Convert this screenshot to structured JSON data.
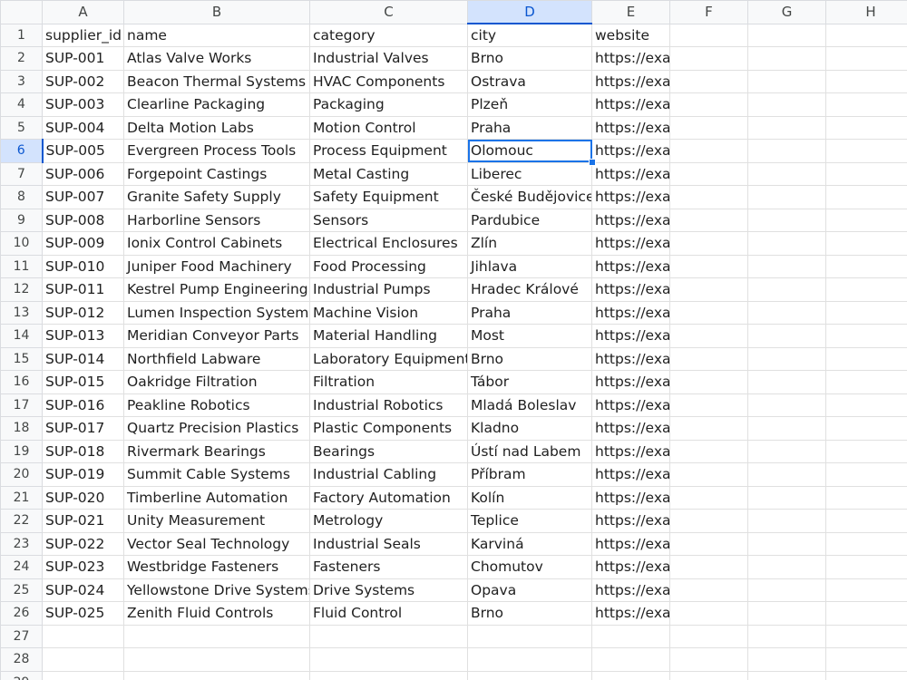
{
  "sheet": {
    "columns": [
      "A",
      "B",
      "C",
      "D",
      "E",
      "F",
      "G",
      "H"
    ],
    "selected_column": "D",
    "selected_row": 6,
    "selected_cell": "D6",
    "rows": [
      [
        "supplier_id",
        "name",
        "category",
        "city",
        "website",
        "",
        "",
        ""
      ],
      [
        "SUP-001",
        "Atlas Valve Works",
        "Industrial Valves",
        "Brno",
        "https://example.invalid/atlas-valve",
        "",
        "",
        ""
      ],
      [
        "SUP-002",
        "Beacon Thermal Systems",
        "HVAC Components",
        "Ostrava",
        "https://example.invalid/beacon-thermal",
        "",
        "",
        ""
      ],
      [
        "SUP-003",
        "Clearline Packaging",
        "Packaging",
        "Plzeň",
        "https://example.invalid/clearline",
        "",
        "",
        ""
      ],
      [
        "SUP-004",
        "Delta Motion Labs",
        "Motion Control",
        "Praha",
        "https://example.invalid/delta-motion",
        "",
        "",
        ""
      ],
      [
        "SUP-005",
        "Evergreen Process Tools",
        "Process Equipment",
        "Olomouc",
        "https://example.invalid/evergreen-process",
        "",
        "",
        ""
      ],
      [
        "SUP-006",
        "Forgepoint Castings",
        "Metal Casting",
        "Liberec",
        "https://example.invalid/forgepoint",
        "",
        "",
        ""
      ],
      [
        "SUP-007",
        "Granite Safety Supply",
        "Safety Equipment",
        "České Budějovice",
        "https://example.invalid/granite-safety",
        "",
        "",
        ""
      ],
      [
        "SUP-008",
        "Harborline Sensors",
        "Sensors",
        "Pardubice",
        "https://example.invalid/harborline",
        "",
        "",
        ""
      ],
      [
        "SUP-009",
        "Ionix Control Cabinets",
        "Electrical Enclosures",
        "Zlín",
        "https://example.invalid/ionix",
        "",
        "",
        ""
      ],
      [
        "SUP-010",
        "Juniper Food Machinery",
        "Food Processing",
        "Jihlava",
        "https://example.invalid/juniper-food",
        "",
        "",
        ""
      ],
      [
        "SUP-011",
        "Kestrel Pump Engineering",
        "Industrial Pumps",
        "Hradec Králové",
        "https://example.invalid/kestrel-pump",
        "",
        "",
        ""
      ],
      [
        "SUP-012",
        "Lumen Inspection Systems",
        "Machine Vision",
        "Praha",
        "https://example.invalid/lumen-inspection",
        "",
        "",
        ""
      ],
      [
        "SUP-013",
        "Meridian Conveyor Parts",
        "Material Handling",
        "Most",
        "https://example.invalid/meridian-conveyor",
        "",
        "",
        ""
      ],
      [
        "SUP-014",
        "Northfield Labware",
        "Laboratory Equipment",
        "Brno",
        "https://example.invalid/northfield-labware",
        "",
        "",
        ""
      ],
      [
        "SUP-015",
        "Oakridge Filtration",
        "Filtration",
        "Tábor",
        "https://example.invalid/oakridge-filtration",
        "",
        "",
        ""
      ],
      [
        "SUP-016",
        "Peakline Robotics",
        "Industrial Robotics",
        "Mladá Boleslav",
        "https://example.invalid/peakline-robotics",
        "",
        "",
        ""
      ],
      [
        "SUP-017",
        "Quartz Precision Plastics",
        "Plastic Components",
        "Kladno",
        "https://example.invalid/quartz-plastics",
        "",
        "",
        ""
      ],
      [
        "SUP-018",
        "Rivermark Bearings",
        "Bearings",
        "Ústí nad Labem",
        "https://example.invalid/rivermark-bearings",
        "",
        "",
        ""
      ],
      [
        "SUP-019",
        "Summit Cable Systems",
        "Industrial Cabling",
        "Příbram",
        "https://example.invalid/summit-cable",
        "",
        "",
        ""
      ],
      [
        "SUP-020",
        "Timberline Automation",
        "Factory Automation",
        "Kolín",
        "https://example.invalid/timberline-automatio",
        "",
        "",
        ""
      ],
      [
        "SUP-021",
        "Unity Measurement",
        "Metrology",
        "Teplice",
        "https://example.invalid/unity-measurement",
        "",
        "",
        ""
      ],
      [
        "SUP-022",
        "Vector Seal Technology",
        "Industrial Seals",
        "Karviná",
        "https://example.invalid/vector-seal",
        "",
        "",
        ""
      ],
      [
        "SUP-023",
        "Westbridge Fasteners",
        "Fasteners",
        "Chomutov",
        "https://example.invalid/westbridge-fasteners",
        "",
        "",
        ""
      ],
      [
        "SUP-024",
        "Yellowstone Drive Systems",
        "Drive Systems",
        "Opava",
        "https://example.invalid/yellowstone-drive",
        "",
        "",
        ""
      ],
      [
        "SUP-025",
        "Zenith Fluid Controls",
        "Fluid Control",
        "Brno",
        "https://example.invalid/zenith-fluid",
        "",
        "",
        ""
      ],
      [
        "",
        "",
        "",
        "",
        "",
        "",
        "",
        ""
      ],
      [
        "",
        "",
        "",
        "",
        "",
        "",
        "",
        ""
      ],
      [
        "",
        "",
        "",
        "",
        "",
        "",
        "",
        ""
      ]
    ]
  },
  "colors": {
    "header_bg": "#f8f9fa",
    "selected_header_bg": "#d3e3fd",
    "selection_border": "#1a73e8",
    "gridline": "#e0e0e0"
  }
}
